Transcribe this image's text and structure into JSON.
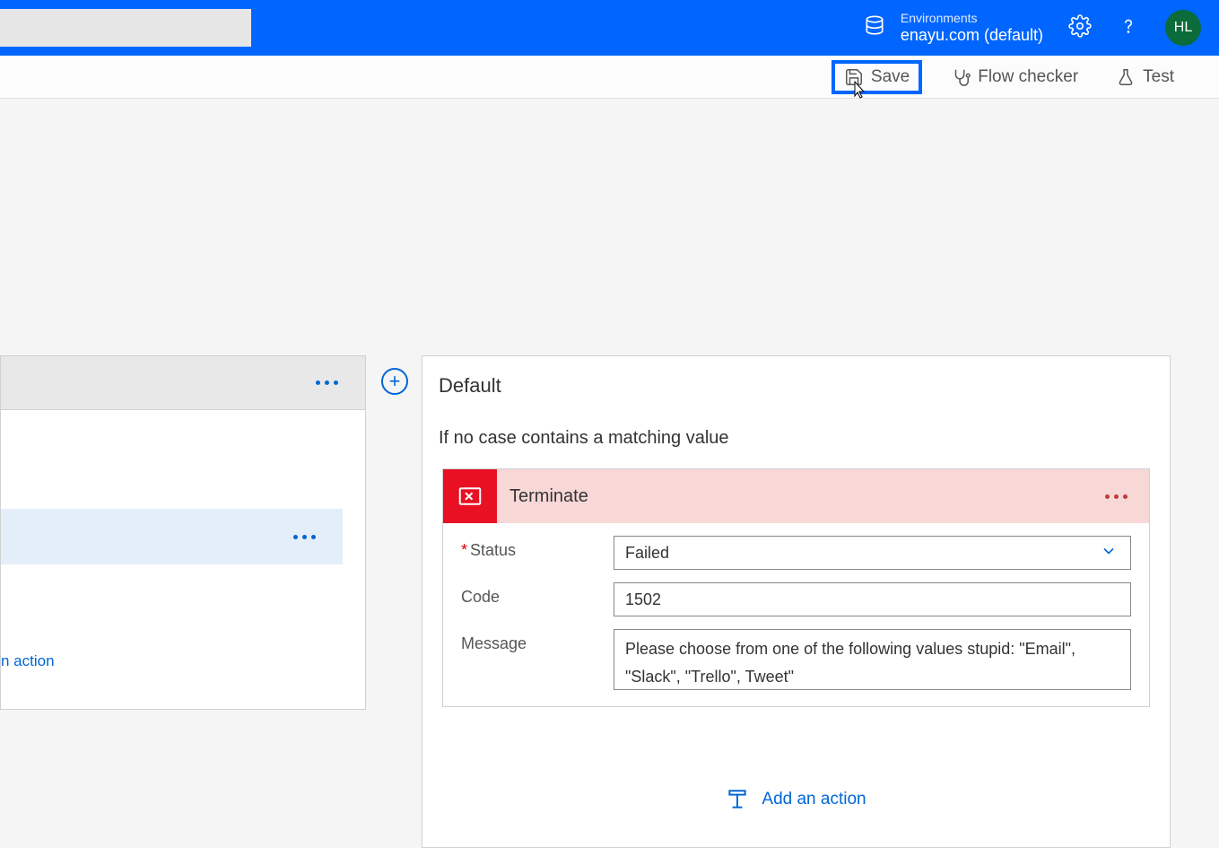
{
  "header": {
    "env_label": "Environments",
    "env_name": "enayu.com (default)",
    "avatar_initials": "HL"
  },
  "toolbar": {
    "save_label": "Save",
    "flow_checker_label": "Flow checker",
    "test_label": "Test"
  },
  "left_card": {
    "add_action_link": "n action"
  },
  "default_card": {
    "title": "Default",
    "subtitle": "If no case contains a matching value"
  },
  "terminate": {
    "title": "Terminate",
    "fields": {
      "status_label": "Status",
      "status_value": "Failed",
      "code_label": "Code",
      "code_value": "1502",
      "message_label": "Message",
      "message_value": "Please choose from one of the following values stupid: \"Email\", \"Slack\", \"Trello\", Tweet\""
    }
  },
  "add_action_label": "Add an action"
}
